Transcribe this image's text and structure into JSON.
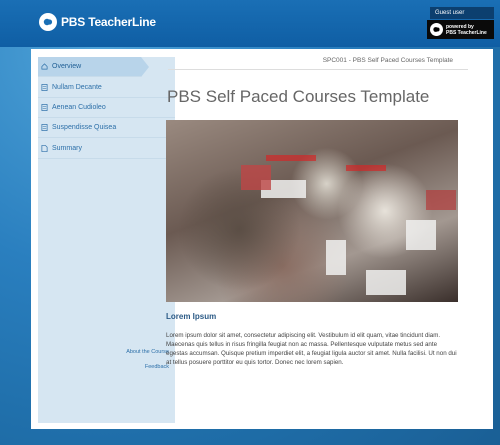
{
  "header": {
    "brand": "PBS TeacherLine",
    "user_status": "Guest user",
    "powered_line1": "powered by",
    "powered_line2": "PBS TeacherLine"
  },
  "sidebar": {
    "items": [
      {
        "label": "Overview",
        "icon": "home-icon"
      },
      {
        "label": "Nullam Decante",
        "icon": "page-icon"
      },
      {
        "label": "Aenean Cudioleo",
        "icon": "page-icon"
      },
      {
        "label": "Suspendisse Quisea",
        "icon": "page-icon"
      },
      {
        "label": "Summary",
        "icon": "document-icon"
      }
    ],
    "footer_links": [
      "About the Course",
      "Feedback"
    ]
  },
  "main": {
    "course_code": "SPC001 - PBS Self Paced Courses Template",
    "title": "PBS Self Paced Courses Template",
    "section_heading": "Lorem Ipsum",
    "body": "Lorem ipsum dolor sit amet, consectetur adipiscing elit. Vestibulum id elit quam, vitae tincidunt diam. Maecenas quis tellus in risus fringilla feugiat non ac massa. Pellentesque vulputate metus sed ante egestas accumsan. Quisque pretium imperdiet elit, a feugiat ligula auctor sit amet. Nulla facilisi. Ut non dui at tellus posuere porttitor eu quis tortor. Donec nec lorem sapien."
  },
  "colors": {
    "header_blue": "#1a6fb5",
    "sidebar_bg": "#d6e6f2",
    "link_blue": "#2c6fa8"
  }
}
